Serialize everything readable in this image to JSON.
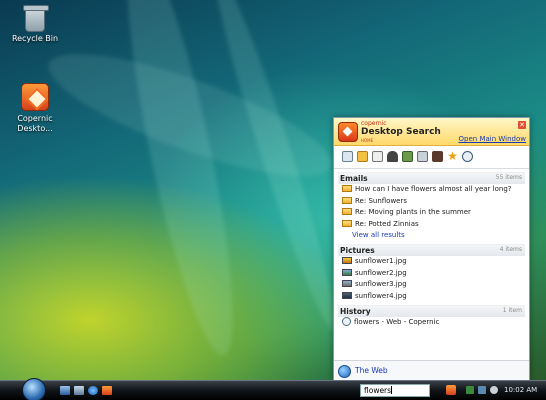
{
  "desktop": {
    "icons": [
      {
        "name": "recycle-bin",
        "label": "Recycle Bin"
      },
      {
        "name": "copernic",
        "label_line1": "Copernic",
        "label_line2": "Deskto..."
      }
    ]
  },
  "panel": {
    "brand": "copernic",
    "title": "Desktop Search",
    "home": "HOME",
    "open_link": "Open Main Window",
    "close": "✕",
    "toolbar_icons": [
      "all-icon",
      "email-icon",
      "files-icon",
      "music-icon",
      "pictures-icon",
      "videos-icon",
      "contacts-icon",
      "favorites-icon",
      "history-icon"
    ],
    "emails": {
      "title": "Emails",
      "count": "55 items",
      "items": [
        "How can I have flowers almost all year long?",
        "Re: Sunflowers",
        "Re: Moving plants in the summer",
        "Re: Potted Zinnias"
      ],
      "view_all": "View all results"
    },
    "pictures": {
      "title": "Pictures",
      "count": "4 items",
      "items": [
        "sunflower1.jpg",
        "sunflower2.jpg",
        "sunflower3.jpg",
        "sunflower4.jpg"
      ]
    },
    "history": {
      "title": "History",
      "count": "1 item",
      "items": [
        "flowers - Web - Copernic"
      ]
    },
    "footer_link": "The Web"
  },
  "taskbar": {
    "search_value": "flowers",
    "clock": "10:02 AM"
  }
}
